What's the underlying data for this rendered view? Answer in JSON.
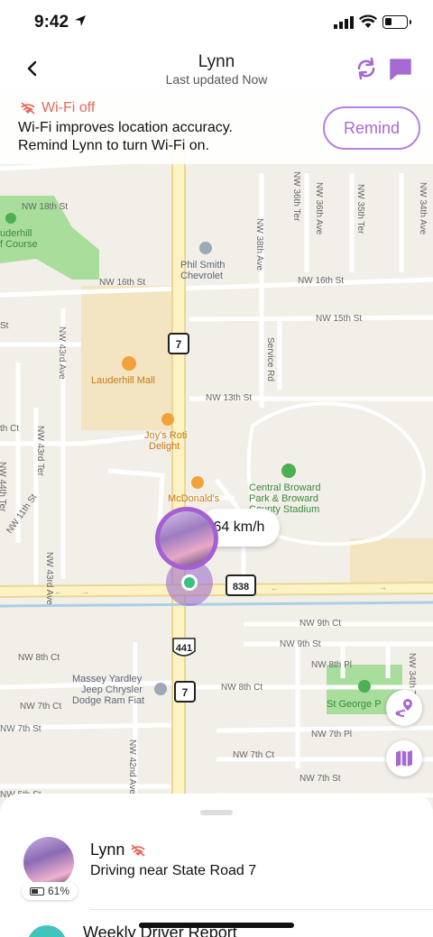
{
  "status_bar": {
    "time": "9:42",
    "battery_level": 0.3
  },
  "header": {
    "title": "Lynn",
    "subtitle": "Last updated Now"
  },
  "banner": {
    "warning": "Wi-Fi off",
    "message_line1": "Wi-Fi improves location accuracy.",
    "message_line2": "Remind Lynn to turn Wi-Fi on.",
    "remind_label": "Remind"
  },
  "map": {
    "labels": {
      "nw18": "NW 18th St",
      "lauderhill_course_1": "uderhill",
      "lauderhill_course_2": "f Course",
      "phil_smith_1": "Phil Smith",
      "phil_smith_2": "Chevrolet",
      "nw16_a": "NW 16th St",
      "nw16_b": "NW 16th St",
      "nw15": "NW 15th St",
      "st_left": "St",
      "nw43_ave": "NW 43rd Ave",
      "lauderhill_mall": "Lauderhill Mall",
      "nw13": "NW 13th St",
      "joys_1": "Joy's Roti",
      "joys_2": "Delight",
      "nw43_ter": "NW 43rd Ter",
      "nw44_ter": "NW 44th Ter",
      "nw11": "NW 11th St",
      "th_ct": "th Ct",
      "mcdonalds": "McDonald's",
      "central_1": "Central Broward",
      "central_2": "Park & Broward",
      "central_3": "County Stadium",
      "nw43_ave_b": "NW 43rd Ave",
      "nw38_ave": "NW 38th Ave",
      "service_rd": "Service Rd",
      "nw36_ter": "NW 36th Ter",
      "nw36_ave": "NW 36th Ave",
      "nw35_ter": "NW 35th Ter",
      "nw34_ave": "NW 34th Ave",
      "nw9_ct": "NW 9th Ct",
      "nw9_st": "NW 9th St",
      "nw8_pl": "NW 8th Pl",
      "nw8_ct_left": "NW 8th Ct",
      "nw8_ct_right": "NW 8th Ct",
      "massey_1": "Massey Yardley",
      "massey_2": "Jeep Chrysler",
      "massey_3": "Dodge Ram Fiat",
      "nw7_ct_left": "NW 7th Ct",
      "nw7_st_left": "NW 7th St",
      "nw7_pl": "NW 7th Pl",
      "nw7_ct_mid": "NW 7th Ct",
      "nw7_st_right": "NW 7th St",
      "nw42_ave": "NW 42nd Ave",
      "nw34_ter": "NW 34th Ter",
      "st_george": "St George P",
      "nw5": "NW 5th St",
      "shield_7a": "7",
      "shield_7b": "7",
      "shield_838": "838",
      "shield_441": "441"
    }
  },
  "speed": "64 km/h",
  "member": {
    "name": "Lynn",
    "status": "Driving near State Road 7",
    "battery": "61%",
    "battery_level": 0.61
  },
  "report": {
    "label": "Weekly Driver Report"
  },
  "colors": {
    "accent": "#a56ad2",
    "warning": "#e8695b",
    "road": "#fdf2c4",
    "park": "#a9dd9c"
  }
}
